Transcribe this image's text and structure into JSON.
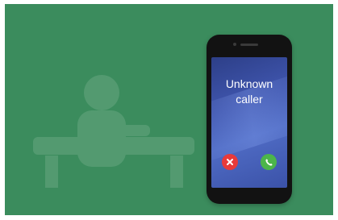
{
  "caller": {
    "line1": "Unknown",
    "line2": "caller"
  },
  "icons": {
    "decline": "decline-call-icon",
    "accept": "accept-call-icon"
  },
  "colors": {
    "background": "#3b8c5d",
    "decline": "#e83a3a",
    "accept": "#4cb54a",
    "phone_body": "#121212"
  }
}
